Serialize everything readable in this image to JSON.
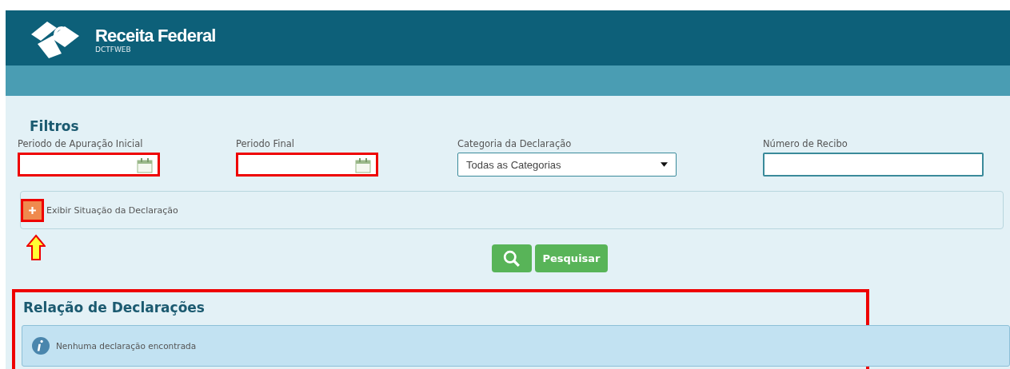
{
  "header": {
    "brand": "Receita Federal",
    "subtitle": "DCTFWEB"
  },
  "filters": {
    "title": "Filtros",
    "fields": [
      {
        "kind": "date",
        "label": "Periodo de Apuração Inicial",
        "highlighted": true
      },
      {
        "kind": "date",
        "label": "Periodo Final",
        "highlighted": true
      },
      {
        "kind": "select",
        "label": "Categoria da Declaração",
        "value": "Todas as Categorias",
        "highlighted": false
      },
      {
        "kind": "text",
        "label": "Número de Recibo",
        "highlighted": false
      }
    ],
    "toggle": {
      "label": "Exibir Situação da Declaração",
      "expanded": false,
      "highlighted": true
    },
    "search_button": "Pesquisar"
  },
  "results": {
    "title": "Relação de Declarações",
    "message": "Nenhuma declaração encontrada",
    "highlighted": true
  }
}
